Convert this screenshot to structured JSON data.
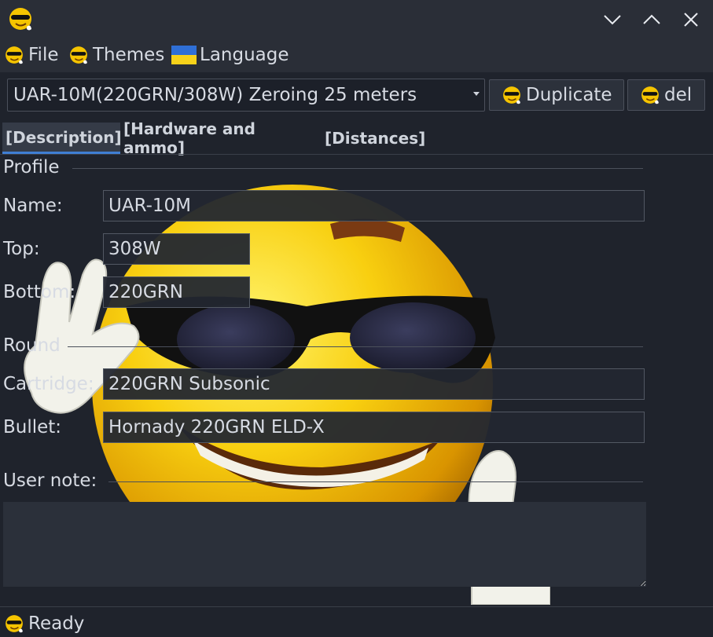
{
  "menu": {
    "file": "File",
    "themes": "Themes",
    "language": "Language"
  },
  "profile_selector": {
    "selected": "UAR-10M(220GRN/308W) Zeroing 25 meters"
  },
  "buttons": {
    "duplicate": "Duplicate",
    "delete": "del"
  },
  "tabs": [
    {
      "label": "[Description]",
      "active": true
    },
    {
      "label": "[Hardware and ammo]",
      "active": false
    },
    {
      "label": "[Distances]",
      "active": false
    }
  ],
  "profile_group": {
    "title": "Profile",
    "name_label": "Name:",
    "name_value": "UAR-10M",
    "top_label": "Top:",
    "top_value": "308W",
    "bottom_label": "Bottom:",
    "bottom_value": "220GRN"
  },
  "round_group": {
    "title": "Round",
    "cartridge_label": "Cartridge:",
    "cartridge_value": "220GRN Subsonic",
    "bullet_label": "Bullet:",
    "bullet_value": "Hornady 220GRN ELD-X"
  },
  "user_note": {
    "title": "User note:",
    "value": ""
  },
  "status": {
    "text": "Ready"
  },
  "colors": {
    "background": "#1f232c",
    "accent": "#3f7fd4",
    "emoji_yellow": "#f5c400",
    "flag_blue": "#2f6fd6",
    "flag_yellow": "#f7d21a"
  },
  "icons": {
    "app": "sunglasses-emoji-icon",
    "window_minimize": "chevron-down-icon",
    "window_maximize": "chevron-up-icon",
    "window_close": "close-icon",
    "language": "ukraine-flag-icon"
  }
}
